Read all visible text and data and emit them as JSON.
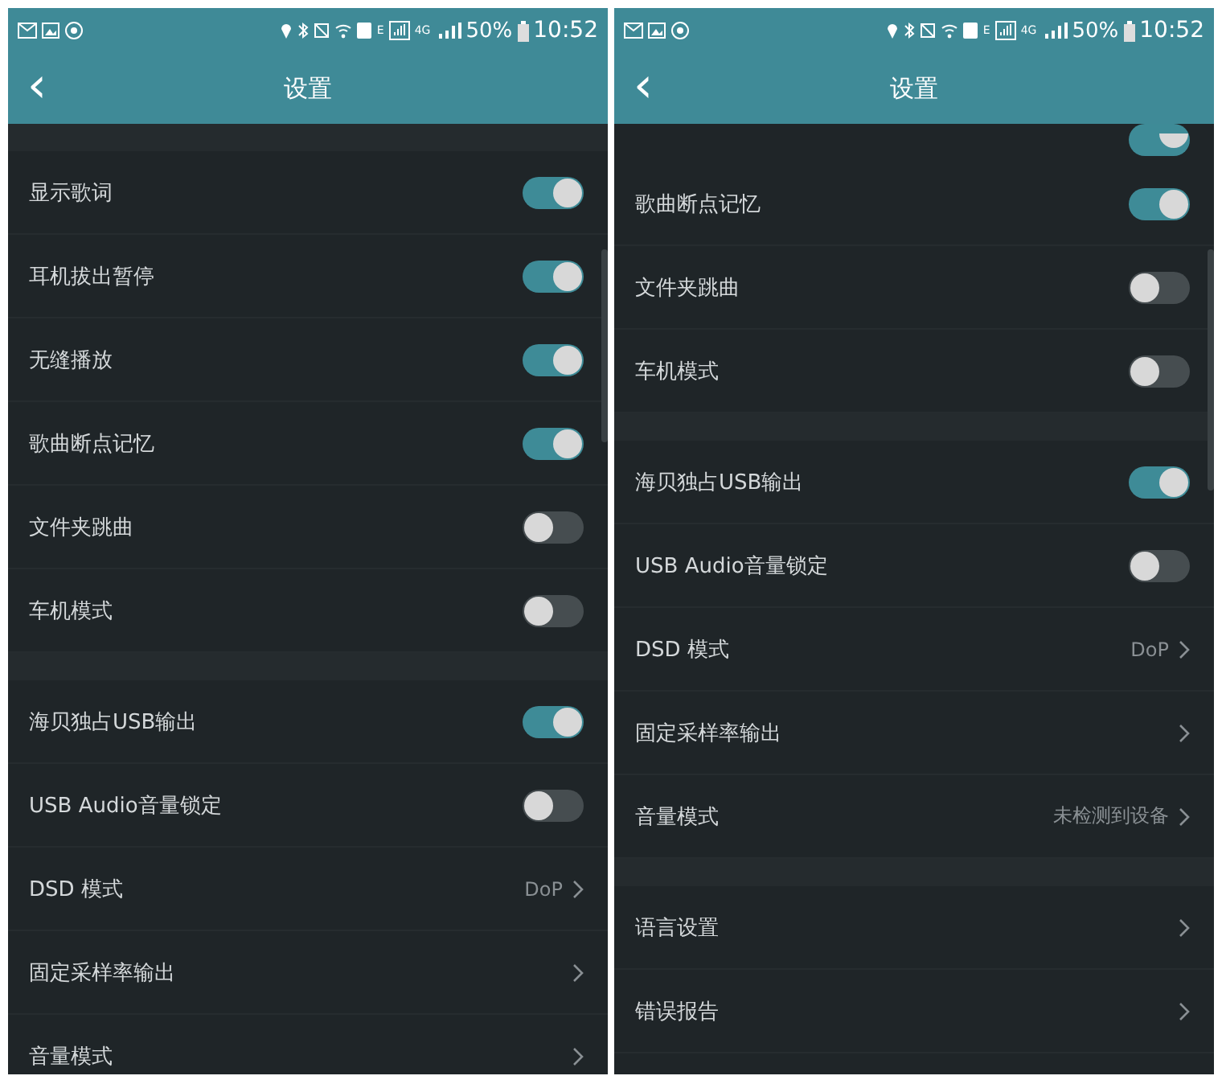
{
  "panels": [
    {
      "status_bar": {
        "network": "E",
        "network_2": "4G",
        "battery": "50%",
        "time": "10:52"
      },
      "header": {
        "back": "‹",
        "title": "设置"
      },
      "continued": false,
      "sections": [
        {
          "items": [
            {
              "kind": "toggle",
              "label": "显示歌词",
              "on": true
            },
            {
              "kind": "toggle",
              "label": "耳机拔出暂停",
              "on": true
            },
            {
              "kind": "toggle",
              "label": "无缝播放",
              "on": true
            },
            {
              "kind": "toggle",
              "label": "歌曲断点记忆",
              "on": true
            },
            {
              "kind": "toggle",
              "label": "文件夹跳曲",
              "on": false
            },
            {
              "kind": "toggle",
              "label": "车机模式",
              "on": false
            }
          ]
        },
        {
          "items": [
            {
              "kind": "toggle",
              "label": "海贝独占USB输出",
              "on": true
            },
            {
              "kind": "toggle",
              "label": "USB Audio音量锁定",
              "on": false
            },
            {
              "kind": "link",
              "label": "DSD 模式",
              "value": "DoP"
            },
            {
              "kind": "link",
              "label": "固定采样率输出"
            },
            {
              "kind": "link",
              "label": "音量模式"
            }
          ]
        }
      ]
    },
    {
      "status_bar": {
        "network": "E",
        "network_2": "4G",
        "battery": "50%",
        "time": "10:52"
      },
      "header": {
        "back": "‹",
        "title": "设置"
      },
      "continued": true,
      "sections": [
        {
          "items": [
            {
              "kind": "toggle",
              "label": "歌曲断点记忆",
              "on": true
            },
            {
              "kind": "toggle",
              "label": "文件夹跳曲",
              "on": false
            },
            {
              "kind": "toggle",
              "label": "车机模式",
              "on": false
            }
          ]
        },
        {
          "items": [
            {
              "kind": "toggle",
              "label": "海贝独占USB输出",
              "on": true
            },
            {
              "kind": "toggle",
              "label": "USB Audio音量锁定",
              "on": false
            },
            {
              "kind": "link",
              "label": "DSD 模式",
              "value": "DoP"
            },
            {
              "kind": "link",
              "label": "固定采样率输出"
            },
            {
              "kind": "link",
              "label": "音量模式",
              "value": "未检测到设备"
            }
          ]
        },
        {
          "items": [
            {
              "kind": "link",
              "label": "语言设置"
            },
            {
              "kind": "link",
              "label": "错误报告"
            }
          ]
        }
      ]
    }
  ]
}
